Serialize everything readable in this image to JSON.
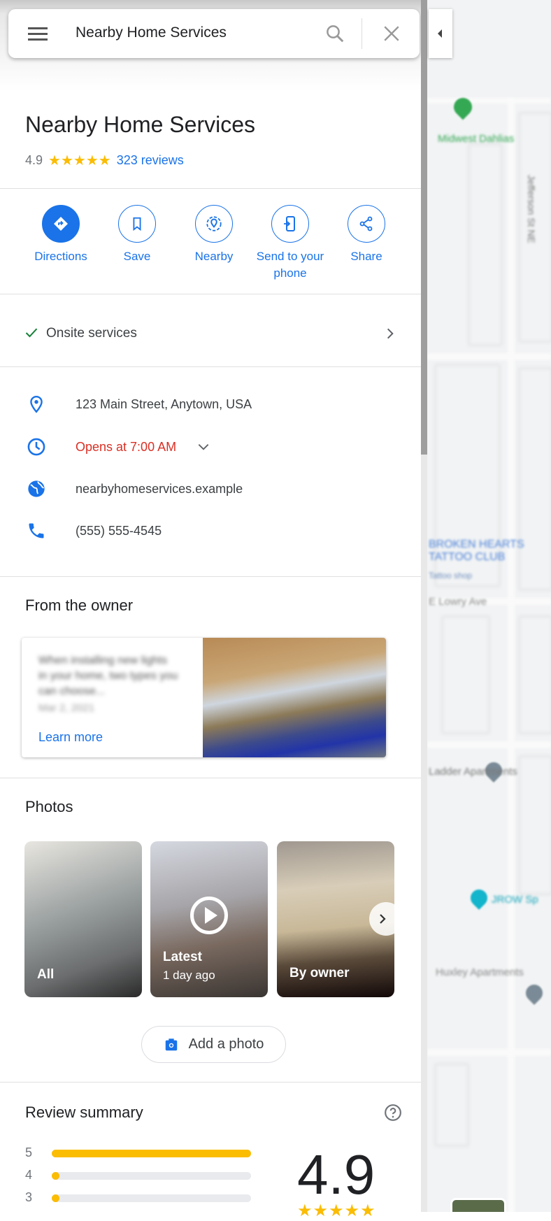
{
  "search": {
    "query": "Nearby Home Services"
  },
  "place": {
    "name": "Nearby Home Services",
    "rating": "4.9",
    "stars": "★★★★★",
    "reviews": "323 reviews"
  },
  "actions": [
    {
      "label": "Directions"
    },
    {
      "label": "Save"
    },
    {
      "label": "Nearby"
    },
    {
      "label": "Send to your phone"
    },
    {
      "label": "Share"
    }
  ],
  "service": {
    "label": "Onsite services"
  },
  "info": {
    "address": "123 Main Street, Anytown, USA",
    "hours": "Opens at 7:00 AM",
    "website": "nearbyhomeservices.example",
    "phone": "(555) 555-4545"
  },
  "owner": {
    "title": "From the owner",
    "post_text": "When installing new lights in your home, two types you can choose...",
    "post_date": "Mar 2, 2021",
    "link": "Learn more"
  },
  "photos": {
    "title": "Photos",
    "tiles": [
      {
        "label": "All"
      },
      {
        "label": "Latest",
        "sub": "1 day ago"
      },
      {
        "label": "By owner"
      }
    ],
    "add_label": "Add a photo"
  },
  "review_summary": {
    "title": "Review summary",
    "rating": "4.9",
    "stars": "★★★★★",
    "bars": [
      {
        "stars": "5",
        "fraction": 1.0
      },
      {
        "stars": "4",
        "fraction": 0.04
      },
      {
        "stars": "3",
        "fraction": 0.02
      }
    ]
  },
  "map": {
    "labels": [
      "Midwest Dahlias",
      "Jefferson St NE",
      "BROKEN HEARTS TATTOO CLUB",
      "Tattoo shop",
      "E Lowry Ave",
      "Ladder Apartments",
      "JROW Sp",
      "Huxley Apartments"
    ]
  },
  "colors": {
    "accent": "#1a73e8",
    "star": "#fbbc04",
    "closed": "#d93025",
    "check": "#188038"
  }
}
